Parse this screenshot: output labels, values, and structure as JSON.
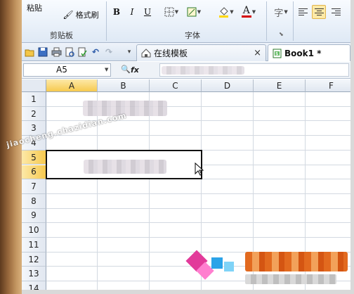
{
  "ribbon": {
    "paste_label": "粘贴",
    "format_painter_label": "格式刷",
    "clipboard_group": "剪贴板",
    "font_group": "字体",
    "bold": "B",
    "italic": "I",
    "underline": "U",
    "font_color_glyph": "A"
  },
  "quick_access": {
    "tabs": [
      {
        "label": "在线模板",
        "close_glyph": "×"
      },
      {
        "label": "Book1 *"
      }
    ]
  },
  "formula_bar": {
    "name_box": "A5",
    "fx": "fx"
  },
  "grid": {
    "columns": [
      "A",
      "B",
      "C",
      "D",
      "E",
      "F"
    ],
    "active_column": "A",
    "rows": [
      "1",
      "2",
      "3",
      "4",
      "5",
      "6",
      "7",
      "8",
      "9",
      "10",
      "11",
      "12",
      "13",
      "14"
    ],
    "active_rows": [
      "5",
      "6"
    ]
  },
  "overlay": {
    "watermark": "jiaocheng.chazidian.com"
  },
  "colors": {
    "active_header": "#f6c94f",
    "selection_border": "#111111",
    "ribbon_bg": "#dfe9f5"
  }
}
